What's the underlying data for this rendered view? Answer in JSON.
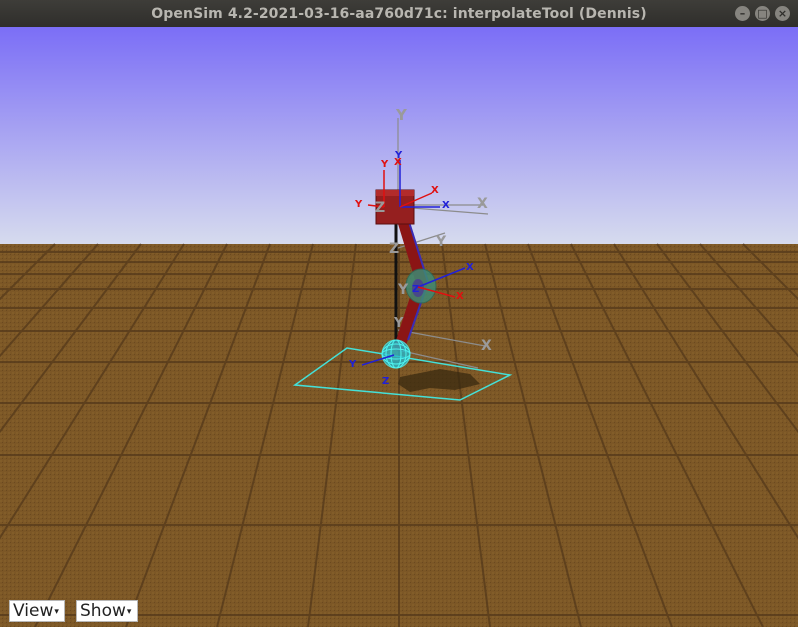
{
  "window": {
    "title": "OpenSim 4.2-2021-03-16-aa760d71c: interpolateTool (Dennis)",
    "buttons": {
      "minimize": "–",
      "maximize": "□",
      "close": "×"
    }
  },
  "scene": {
    "sky_top": "#7b6ef6",
    "sky_bottom": "#d6dbee",
    "floor_color": "#7a5624",
    "axis_labels": [
      "Y",
      "Y",
      "X",
      "Y",
      "Y",
      "Z",
      "X",
      "X",
      "X",
      "Y",
      "Z",
      "Y",
      "X",
      "Z",
      "X",
      "Y",
      "Y",
      "Z",
      "X"
    ]
  },
  "toolbar": {
    "view_label": "View",
    "show_label": "Show",
    "caret": "▾"
  }
}
